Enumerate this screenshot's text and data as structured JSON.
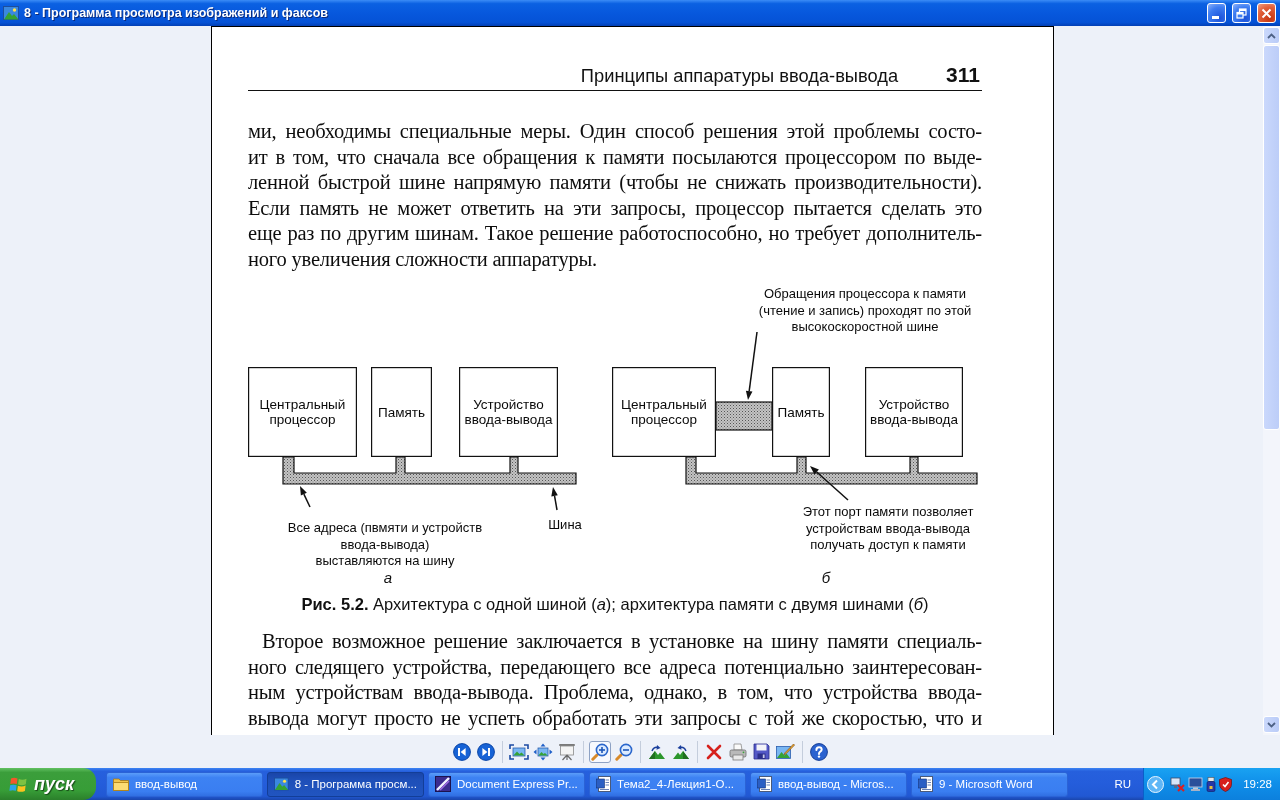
{
  "window": {
    "title": "8 - Программа просмотра изображений и факсов"
  },
  "page": {
    "running_head": {
      "title": "Принципы аппаратуры ввода-вывода",
      "page_number": "311"
    },
    "paragraph_top": {
      "lines": [
        "ми, необходимы специальные меры. Один способ решения этой проблемы состо-",
        "ит в том, что сначала все обращения к памяти посылаются процессором по выде-",
        "ленной быстрой шине напрямую памяти (чтобы не снижать производительности).",
        "Если память не может ответить на эти запросы, процессор пытается сделать это",
        "еще раз по другим шинам. Такое решение работоспособно, но требует дополнитель-",
        "ного увеличения сложности аппаратуры."
      ]
    },
    "figure": {
      "diagrams": [
        {
          "kind": "single_bus",
          "letter": "а",
          "blocks": [
            {
              "lines": [
                "Центральный",
                "процессор"
              ]
            },
            {
              "lines": [
                "Память"
              ]
            },
            {
              "lines": [
                "Устройство",
                "ввода-вывода"
              ]
            }
          ],
          "callouts": [
            {
              "lines": [
                "Все адреса (пвмяти и устройств",
                "ввода-вывода)",
                "выставляются на шину"
              ]
            },
            {
              "lines": [
                "Шина"
              ]
            }
          ]
        },
        {
          "kind": "dual_bus",
          "letter": "б",
          "blocks": [
            {
              "lines": [
                "Центральный",
                "процессор"
              ]
            },
            {
              "lines": [
                "Память"
              ]
            },
            {
              "lines": [
                "Устройство",
                "ввода-вывода"
              ]
            }
          ],
          "callouts": [
            {
              "lines": [
                "Обращения процессора к памяти",
                "(чтение и запись) проходят по этой",
                "высокоскоростной шине"
              ]
            },
            {
              "lines": [
                "Этот порт памяти позволяет",
                "устройствам ввода-вывода",
                "получать доступ к памяти"
              ]
            }
          ]
        }
      ],
      "caption": "**Рис. 5.2.** Архитектура с одной шиной (*а*); архитектура памяти с двумя шинами (*б*)"
    },
    "paragraph_bottom": {
      "lines": [
        "Второе возможное решение заключается в установке на шину памяти специаль-",
        "ного следящего устройства, передающего все адреса потенциально заинтересован-",
        "ным устройствам ввода-вывода. Проблема, однако, в том, что устройства ввода-",
        "вывода могут просто не успеть обработать эти запросы с той же скоростью, что и"
      ]
    }
  },
  "toolbar": {
    "groups": [
      {
        "tools": [
          {
            "kind": "previous",
            "selected": false
          },
          {
            "kind": "next",
            "selected": false
          }
        ]
      },
      {
        "tools": [
          {
            "kind": "best_fit",
            "selected": false
          },
          {
            "kind": "actual_size",
            "selected": false
          },
          {
            "kind": "slideshow",
            "selected": false
          }
        ]
      },
      {
        "tools": [
          {
            "kind": "zoom_in",
            "selected": true
          },
          {
            "kind": "zoom_out",
            "selected": false
          }
        ]
      },
      {
        "tools": [
          {
            "kind": "rotate_clockwise",
            "selected": false
          },
          {
            "kind": "rotate_counterclockwise",
            "selected": false
          }
        ]
      },
      {
        "tools": [
          {
            "kind": "delete",
            "selected": false
          },
          {
            "kind": "print",
            "selected": false
          },
          {
            "kind": "save",
            "selected": false
          },
          {
            "kind": "edit",
            "selected": false
          }
        ]
      },
      {
        "tools": [
          {
            "kind": "help",
            "selected": false
          }
        ]
      }
    ]
  },
  "taskbar": {
    "start_label": "пуск",
    "items": [
      {
        "kind": "folder",
        "label": "ввод-вывод",
        "selected": false
      },
      {
        "kind": "viewer",
        "label": "8 - Программа просм...",
        "selected": true
      },
      {
        "kind": "scanner",
        "label": "Document Express Pr...",
        "selected": false
      },
      {
        "kind": "word",
        "label": "Тема2_4-Лекция1-О...",
        "selected": false
      },
      {
        "kind": "word",
        "label": "ввод-вывод - Micros...",
        "selected": false
      },
      {
        "kind": "word",
        "label": "9 - Microsoft Word",
        "selected": false
      }
    ],
    "language": "RU",
    "clock": "19:28"
  }
}
